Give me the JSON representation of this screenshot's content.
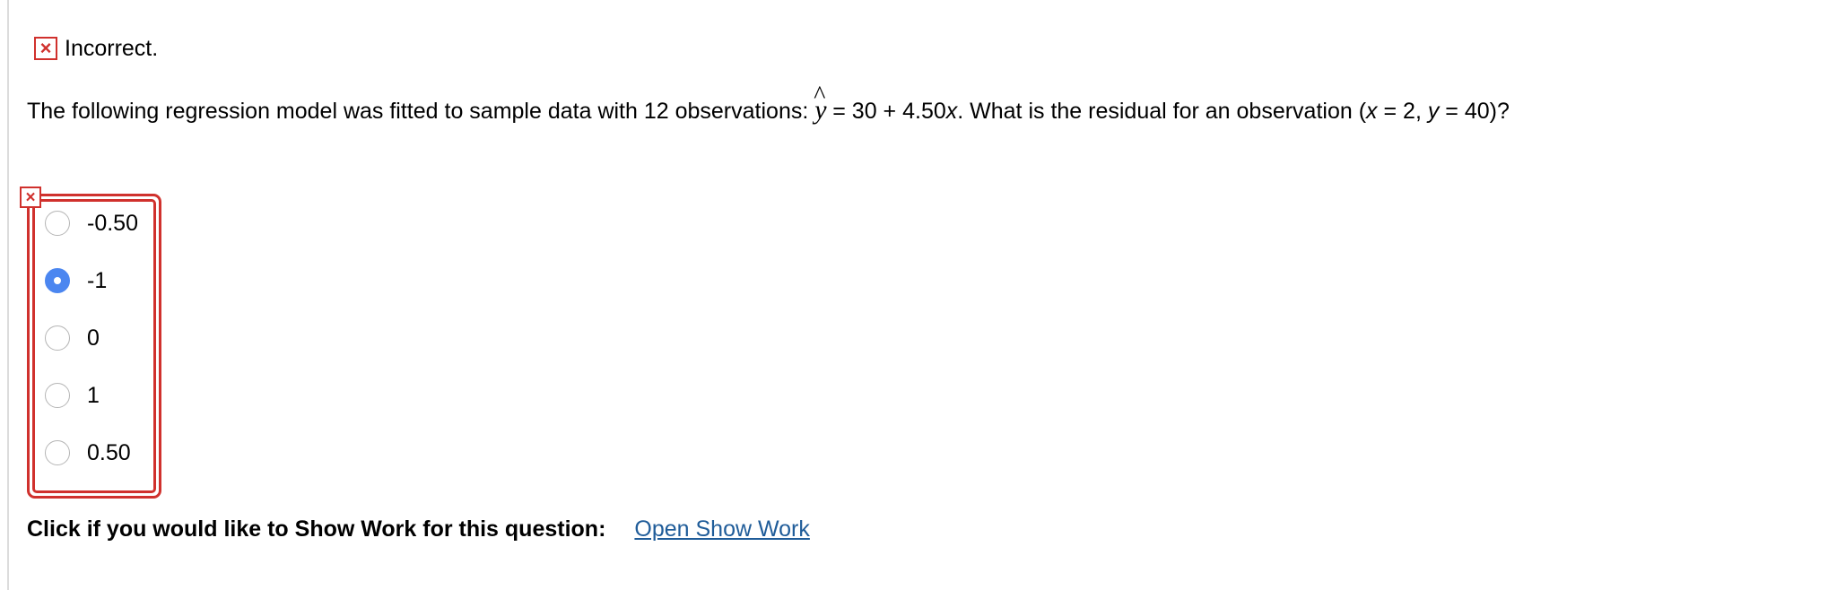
{
  "feedback": {
    "icon": "x-mark-icon",
    "status_label": "Incorrect.",
    "status_color": "#d0312d"
  },
  "question": {
    "text_before": "The following regression model was fitted to sample data with 12 observations:",
    "hat_glyph": "^",
    "yhat_var": "y",
    "equation_rhs": "= 30 + 4.50",
    "x_var": "x",
    "mid_text": ". What is the residual for an observation (",
    "x_var_2": "x",
    "x_value": " = 2, ",
    "y_var": "y",
    "y_value": " = 40)?"
  },
  "answer": {
    "mark_glyph": "×",
    "options": [
      {
        "label": "-0.50",
        "selected": false
      },
      {
        "label": "-1",
        "selected": true
      },
      {
        "label": "0",
        "selected": false
      },
      {
        "label": "1",
        "selected": false
      },
      {
        "label": "0.50",
        "selected": false
      }
    ],
    "selected_color": "#4b86f0"
  },
  "show_work": {
    "prompt": "Click if you would like to Show Work for this question:",
    "link_label": "Open Show Work",
    "link_color": "#1f5c99"
  }
}
